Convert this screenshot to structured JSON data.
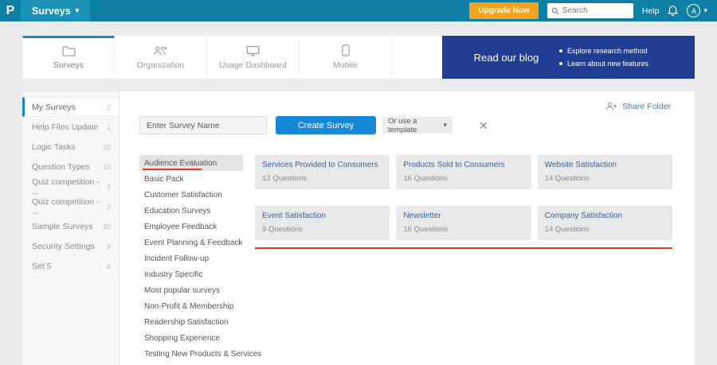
{
  "topbar": {
    "logo": "P",
    "app_menu": "Surveys",
    "upgrade_label": "Upgrade Now",
    "search_placeholder": "Search",
    "help_label": "Help",
    "avatar_initial": "A"
  },
  "icons": {
    "caret_down": "▾",
    "close": "✕"
  },
  "tabs": [
    {
      "label": "Surveys",
      "icon": "folder-icon",
      "active": true
    },
    {
      "label": "Organization",
      "icon": "people-icon",
      "active": false
    },
    {
      "label": "Usage Dashboard",
      "icon": "monitor-icon",
      "active": false
    },
    {
      "label": "Mobile",
      "icon": "phone-icon",
      "active": false
    }
  ],
  "blog_banner": {
    "title": "Read our blog",
    "bullets": [
      "Explore research method",
      "Learn about new features"
    ]
  },
  "sidebar": {
    "items": [
      {
        "label": "My Surveys",
        "count": "2",
        "active": true
      },
      {
        "label": "Help Files Update",
        "count": "1",
        "active": false
      },
      {
        "label": "Logic Tasks",
        "count": "22",
        "active": false
      },
      {
        "label": "Question Types",
        "count": "10",
        "active": false
      },
      {
        "label": "Quiz competition - ...",
        "count": "2",
        "active": false
      },
      {
        "label": "Quiz competition - ...",
        "count": "2",
        "active": false
      },
      {
        "label": "Sample Surveys",
        "count": "22",
        "active": false
      },
      {
        "label": "Security Settings",
        "count": "9",
        "active": false
      },
      {
        "label": "Set 5",
        "count": "4",
        "active": false
      }
    ]
  },
  "share_folder": {
    "label": "Share Folder"
  },
  "create": {
    "input_placeholder": "Enter Survey Name",
    "create_button": "Create Survey",
    "template_dropdown": "Or use a template"
  },
  "template_categories": [
    "Audience Evaluation",
    "Basic Pack",
    "Customer Satisfaction",
    "Education Surveys",
    "Employee Feedback",
    "Event Planning & Feedback",
    "Incident Follow-up",
    "Industry Specific",
    "Most popular surveys",
    "Non-Profit & Membership",
    "Readership Satisfaction",
    "Shopping Experience",
    "Testing New Products & Services"
  ],
  "selected_category": "Audience Evaluation",
  "templates": [
    {
      "title": "Services Provided to Consumers",
      "questions": "13 Questions"
    },
    {
      "title": "Products Sold to Consumers",
      "questions": "16 Questions"
    },
    {
      "title": "Website Satisfaction",
      "questions": "14 Questions"
    },
    {
      "title": "Event Satisfaction",
      "questions": "9 Questions"
    },
    {
      "title": "Newsletter",
      "questions": "16 Questions"
    },
    {
      "title": "Company Satisfaction",
      "questions": "14 Questions"
    }
  ],
  "colors": {
    "topbar": "#0e80a6",
    "accent_blue": "#1b87c9",
    "button_blue": "#1688d8",
    "upgrade_orange": "#f6a21c",
    "banner_navy": "#203d94",
    "annotation_red": "#e23a2c",
    "card_bg": "#e9e9e9"
  }
}
